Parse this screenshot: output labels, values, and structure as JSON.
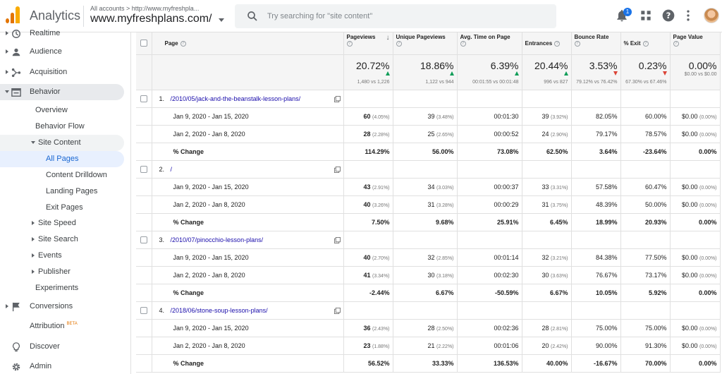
{
  "header": {
    "app_title": "Analytics",
    "breadcrumb": "All accounts > http://www.myfreshpla...",
    "property": "www.myfreshplans.com/",
    "search_placeholder": "Try searching for \"site content\"",
    "notification_count": "1"
  },
  "sidebar": {
    "items": [
      {
        "label": "Realtime",
        "icon": "clock-icon"
      },
      {
        "label": "Audience",
        "icon": "person-icon"
      },
      {
        "label": "Acquisition",
        "icon": "acquisition-icon"
      },
      {
        "label": "Behavior",
        "icon": "behavior-icon"
      },
      {
        "label": "Overview"
      },
      {
        "label": "Behavior Flow"
      },
      {
        "label": "Site Content"
      },
      {
        "label": "All Pages"
      },
      {
        "label": "Content Drilldown"
      },
      {
        "label": "Landing Pages"
      },
      {
        "label": "Exit Pages"
      },
      {
        "label": "Site Speed"
      },
      {
        "label": "Site Search"
      },
      {
        "label": "Events"
      },
      {
        "label": "Publisher"
      },
      {
        "label": "Experiments"
      },
      {
        "label": "Conversions",
        "icon": "flag-icon"
      },
      {
        "label": "Attribution",
        "badge": "BETA",
        "icon": "attribution-icon"
      },
      {
        "label": "Discover",
        "icon": "lightbulb-icon"
      },
      {
        "label": "Admin",
        "icon": "gear-icon"
      }
    ]
  },
  "table": {
    "columns": [
      "Page",
      "Pageviews",
      "Unique Pageviews",
      "Avg. Time on Page",
      "Entrances",
      "Bounce Rate",
      "% Exit",
      "Page Value"
    ],
    "totals": [
      {
        "big": "20.72%",
        "dir": "up",
        "cmp": "1,480 vs 1,226"
      },
      {
        "big": "18.86%",
        "dir": "up",
        "cmp": "1,122 vs 944"
      },
      {
        "big": "6.39%",
        "dir": "up",
        "cmp": "00:01:55 vs 00:01:48"
      },
      {
        "big": "20.44%",
        "dir": "up",
        "cmp": "996 vs 827"
      },
      {
        "big": "3.53%",
        "dir": "down",
        "cmp": "79.12% vs 76.42%"
      },
      {
        "big": "0.23%",
        "dir": "down",
        "cmp": "67.30% vs 67.46%"
      },
      {
        "big": "0.00%",
        "dir": "",
        "cmp": "$0.00 vs $0.00"
      }
    ],
    "groups": [
      {
        "num": "1.",
        "page": "/2010/05/jack-and-the-beanstalk-lesson-plans/",
        "rows": [
          {
            "label": "Jan 9, 2020 - Jan 15, 2020",
            "cells": [
              [
                "60",
                "(4.05%)"
              ],
              [
                "39",
                "(3.48%)"
              ],
              [
                "00:01:30",
                ""
              ],
              [
                "39",
                "(3.92%)"
              ],
              [
                "82.05%",
                ""
              ],
              [
                "60.00%",
                ""
              ],
              [
                "$0.00",
                "(0.00%)"
              ]
            ]
          },
          {
            "label": "Jan 2, 2020 - Jan 8, 2020",
            "cells": [
              [
                "28",
                "(2.28%)"
              ],
              [
                "25",
                "(2.65%)"
              ],
              [
                "00:00:52",
                ""
              ],
              [
                "24",
                "(2.90%)"
              ],
              [
                "79.17%",
                ""
              ],
              [
                "78.57%",
                ""
              ],
              [
                "$0.00",
                "(0.00%)"
              ]
            ]
          }
        ],
        "change": {
          "label": "% Change",
          "cells": [
            "114.29%",
            "56.00%",
            "73.08%",
            "62.50%",
            "3.64%",
            "-23.64%",
            "0.00%"
          ]
        }
      },
      {
        "num": "2.",
        "page": "/",
        "rows": [
          {
            "label": "Jan 9, 2020 - Jan 15, 2020",
            "cells": [
              [
                "43",
                "(2.91%)"
              ],
              [
                "34",
                "(3.03%)"
              ],
              [
                "00:00:37",
                ""
              ],
              [
                "33",
                "(3.31%)"
              ],
              [
                "57.58%",
                ""
              ],
              [
                "60.47%",
                ""
              ],
              [
                "$0.00",
                "(0.00%)"
              ]
            ]
          },
          {
            "label": "Jan 2, 2020 - Jan 8, 2020",
            "cells": [
              [
                "40",
                "(3.26%)"
              ],
              [
                "31",
                "(3.28%)"
              ],
              [
                "00:00:29",
                ""
              ],
              [
                "31",
                "(3.75%)"
              ],
              [
                "48.39%",
                ""
              ],
              [
                "50.00%",
                ""
              ],
              [
                "$0.00",
                "(0.00%)"
              ]
            ]
          }
        ],
        "change": {
          "label": "% Change",
          "cells": [
            "7.50%",
            "9.68%",
            "25.91%",
            "6.45%",
            "18.99%",
            "20.93%",
            "0.00%"
          ]
        }
      },
      {
        "num": "3.",
        "page": "/2010/07/pinocchio-lesson-plans/",
        "rows": [
          {
            "label": "Jan 9, 2020 - Jan 15, 2020",
            "cells": [
              [
                "40",
                "(2.70%)"
              ],
              [
                "32",
                "(2.85%)"
              ],
              [
                "00:01:14",
                ""
              ],
              [
                "32",
                "(3.21%)"
              ],
              [
                "84.38%",
                ""
              ],
              [
                "77.50%",
                ""
              ],
              [
                "$0.00",
                "(0.00%)"
              ]
            ]
          },
          {
            "label": "Jan 2, 2020 - Jan 8, 2020",
            "cells": [
              [
                "41",
                "(3.34%)"
              ],
              [
                "30",
                "(3.18%)"
              ],
              [
                "00:02:30",
                ""
              ],
              [
                "30",
                "(3.63%)"
              ],
              [
                "76.67%",
                ""
              ],
              [
                "73.17%",
                ""
              ],
              [
                "$0.00",
                "(0.00%)"
              ]
            ]
          }
        ],
        "change": {
          "label": "% Change",
          "cells": [
            "-2.44%",
            "6.67%",
            "-50.59%",
            "6.67%",
            "10.05%",
            "5.92%",
            "0.00%"
          ]
        }
      },
      {
        "num": "4.",
        "page": "/2018/06/stone-soup-lesson-plans/",
        "rows": [
          {
            "label": "Jan 9, 2020 - Jan 15, 2020",
            "cells": [
              [
                "36",
                "(2.43%)"
              ],
              [
                "28",
                "(2.50%)"
              ],
              [
                "00:02:36",
                ""
              ],
              [
                "28",
                "(2.81%)"
              ],
              [
                "75.00%",
                ""
              ],
              [
                "75.00%",
                ""
              ],
              [
                "$0.00",
                "(0.00%)"
              ]
            ]
          },
          {
            "label": "Jan 2, 2020 - Jan 8, 2020",
            "cells": [
              [
                "23",
                "(1.88%)"
              ],
              [
                "21",
                "(2.22%)"
              ],
              [
                "00:01:06",
                ""
              ],
              [
                "20",
                "(2.42%)"
              ],
              [
                "90.00%",
                ""
              ],
              [
                "91.30%",
                ""
              ],
              [
                "$0.00",
                "(0.00%)"
              ]
            ]
          }
        ],
        "change": {
          "label": "% Change",
          "cells": [
            "56.52%",
            "33.33%",
            "136.53%",
            "40.00%",
            "-16.67%",
            "70.00%",
            "0.00%"
          ]
        }
      }
    ]
  },
  "colors": {
    "accent": "#1a73e8",
    "up": "#0f9d58",
    "down": "#db4437",
    "link": "#1a0dab",
    "brand": "#f9ab00"
  }
}
